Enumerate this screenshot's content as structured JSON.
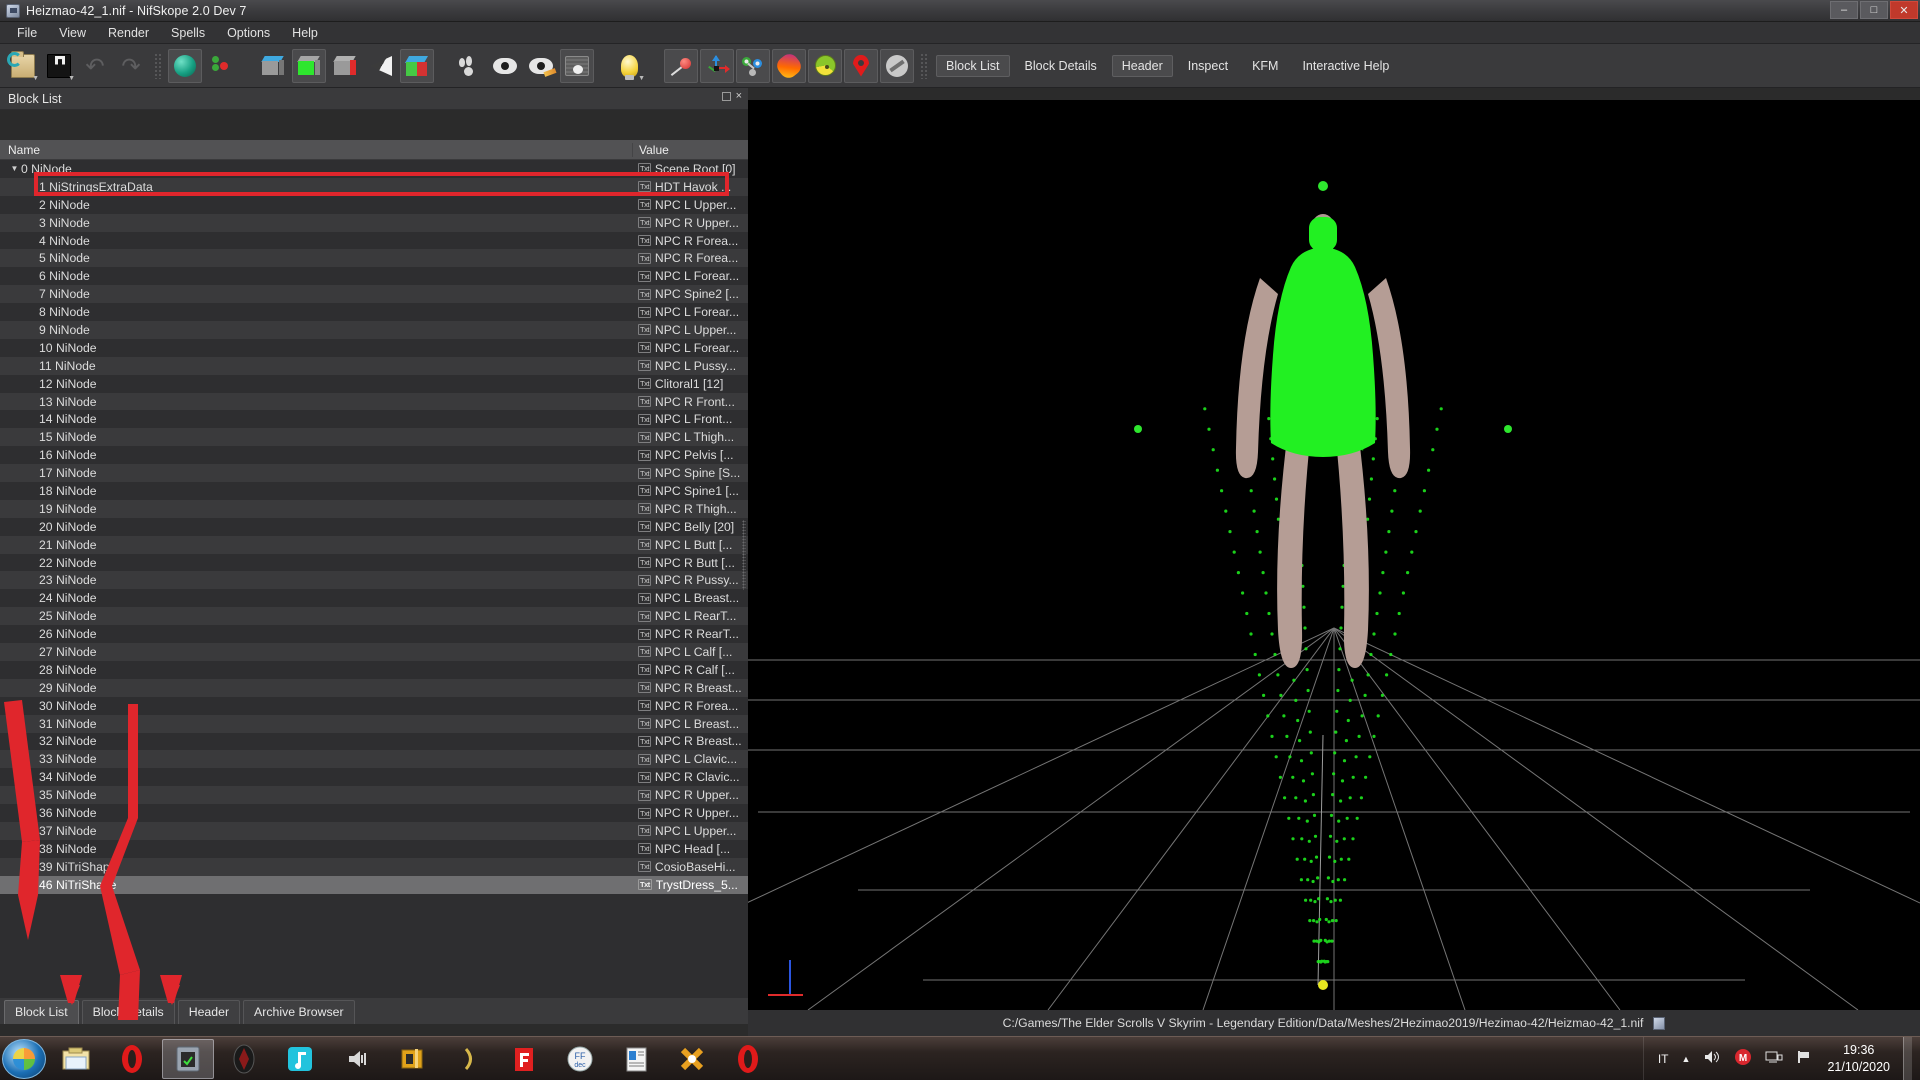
{
  "window": {
    "title": "Heizmao-42_1.nif - NifSkope 2.0 Dev 7",
    "icon": "nifskope-icon",
    "minimize": "–",
    "maximize": "□",
    "close": "✕"
  },
  "menu": [
    {
      "label": "File"
    },
    {
      "label": "View"
    },
    {
      "label": "Render"
    },
    {
      "label": "Spells"
    },
    {
      "label": "Options"
    },
    {
      "label": "Help"
    }
  ],
  "toolbar": {
    "icons": [
      {
        "name": "open-file-icon"
      },
      {
        "name": "save-file-icon"
      },
      {
        "name": "undo-icon"
      },
      {
        "name": "redo-icon"
      },
      {
        "name": "smooth-shading-icon"
      },
      {
        "name": "vertex-selection-icon"
      },
      {
        "name": "draw-nodes-icon"
      },
      {
        "name": "draw-collision-icon"
      },
      {
        "name": "draw-constraints-icon"
      },
      {
        "name": "draw-furniture-icon"
      },
      {
        "name": "axes-cube-icon"
      },
      {
        "name": "paw-icon"
      },
      {
        "name": "eye-icon"
      },
      {
        "name": "eye-highlight-icon"
      },
      {
        "name": "screenshot-icon"
      },
      {
        "name": "lightbulb-icon"
      },
      {
        "name": "pin-marker-icon"
      },
      {
        "name": "transform-axes-icon"
      },
      {
        "name": "node-graph-icon"
      },
      {
        "name": "bone-icon"
      },
      {
        "name": "pie-sphere-icon"
      },
      {
        "name": "marker-icon"
      },
      {
        "name": "hide-icon"
      }
    ],
    "buttons": [
      {
        "label": "Block List",
        "active": false
      },
      {
        "label": "Block Details",
        "active": false
      },
      {
        "label": "Header",
        "active": true
      },
      {
        "label": "Inspect",
        "active": false
      },
      {
        "label": "KFM",
        "active": false
      },
      {
        "label": "Interactive Help",
        "active": false
      }
    ]
  },
  "dock": {
    "title": "Block List",
    "float_button": "□",
    "close_button": "×",
    "collapse_arrow": "▼",
    "expand_arrow": "▲"
  },
  "tree": {
    "columns": [
      "Name",
      "Value"
    ],
    "rows": [
      {
        "index": "0",
        "type": "NiNode",
        "value": "Scene Root [0]",
        "badge": "Txt",
        "twisty": "▼",
        "depth": 0
      },
      {
        "index": "1",
        "type": "NiStringsExtraData",
        "value": "HDT Havok ...",
        "badge": "Txt",
        "twisty": "",
        "depth": 1
      },
      {
        "index": "2",
        "type": "NiNode",
        "value": "NPC L Upper...",
        "badge": "Txt",
        "twisty": "",
        "depth": 1
      },
      {
        "index": "3",
        "type": "NiNode",
        "value": "NPC R Upper...",
        "badge": "Txt",
        "twisty": "",
        "depth": 1
      },
      {
        "index": "4",
        "type": "NiNode",
        "value": "NPC R Forea...",
        "badge": "Txt",
        "twisty": "",
        "depth": 1
      },
      {
        "index": "5",
        "type": "NiNode",
        "value": "NPC R Forea...",
        "badge": "Txt",
        "twisty": "",
        "depth": 1
      },
      {
        "index": "6",
        "type": "NiNode",
        "value": "NPC L Forear...",
        "badge": "Txt",
        "twisty": "",
        "depth": 1
      },
      {
        "index": "7",
        "type": "NiNode",
        "value": "NPC Spine2 [...",
        "badge": "Txt",
        "twisty": "",
        "depth": 1
      },
      {
        "index": "8",
        "type": "NiNode",
        "value": "NPC L Forear...",
        "badge": "Txt",
        "twisty": "",
        "depth": 1
      },
      {
        "index": "9",
        "type": "NiNode",
        "value": "NPC L Upper...",
        "badge": "Txt",
        "twisty": "",
        "depth": 1
      },
      {
        "index": "10",
        "type": "NiNode",
        "value": "NPC L Forear...",
        "badge": "Txt",
        "twisty": "",
        "depth": 1
      },
      {
        "index": "11",
        "type": "NiNode",
        "value": "NPC L Pussy...",
        "badge": "Txt",
        "twisty": "",
        "depth": 1
      },
      {
        "index": "12",
        "type": "NiNode",
        "value": "Clitoral1 [12]",
        "badge": "Txt",
        "twisty": "",
        "depth": 1
      },
      {
        "index": "13",
        "type": "NiNode",
        "value": "NPC R Front...",
        "badge": "Txt",
        "twisty": "",
        "depth": 1
      },
      {
        "index": "14",
        "type": "NiNode",
        "value": "NPC L Front...",
        "badge": "Txt",
        "twisty": "",
        "depth": 1
      },
      {
        "index": "15",
        "type": "NiNode",
        "value": "NPC L Thigh...",
        "badge": "Txt",
        "twisty": "",
        "depth": 1
      },
      {
        "index": "16",
        "type": "NiNode",
        "value": "NPC Pelvis [...",
        "badge": "Txt",
        "twisty": "",
        "depth": 1
      },
      {
        "index": "17",
        "type": "NiNode",
        "value": "NPC Spine [S...",
        "badge": "Txt",
        "twisty": "",
        "depth": 1
      },
      {
        "index": "18",
        "type": "NiNode",
        "value": "NPC Spine1 [...",
        "badge": "Txt",
        "twisty": "",
        "depth": 1
      },
      {
        "index": "19",
        "type": "NiNode",
        "value": "NPC R Thigh...",
        "badge": "Txt",
        "twisty": "",
        "depth": 1
      },
      {
        "index": "20",
        "type": "NiNode",
        "value": "NPC Belly [20]",
        "badge": "Txt",
        "twisty": "",
        "depth": 1
      },
      {
        "index": "21",
        "type": "NiNode",
        "value": "NPC L Butt [...",
        "badge": "Txt",
        "twisty": "",
        "depth": 1
      },
      {
        "index": "22",
        "type": "NiNode",
        "value": "NPC R Butt [...",
        "badge": "Txt",
        "twisty": "",
        "depth": 1
      },
      {
        "index": "23",
        "type": "NiNode",
        "value": "NPC R Pussy...",
        "badge": "Txt",
        "twisty": "",
        "depth": 1
      },
      {
        "index": "24",
        "type": "NiNode",
        "value": "NPC L Breast...",
        "badge": "Txt",
        "twisty": "",
        "depth": 1
      },
      {
        "index": "25",
        "type": "NiNode",
        "value": "NPC L RearT...",
        "badge": "Txt",
        "twisty": "",
        "depth": 1
      },
      {
        "index": "26",
        "type": "NiNode",
        "value": "NPC R RearT...",
        "badge": "Txt",
        "twisty": "",
        "depth": 1
      },
      {
        "index": "27",
        "type": "NiNode",
        "value": "NPC L Calf [...",
        "badge": "Txt",
        "twisty": "",
        "depth": 1
      },
      {
        "index": "28",
        "type": "NiNode",
        "value": "NPC R Calf [...",
        "badge": "Txt",
        "twisty": "",
        "depth": 1
      },
      {
        "index": "29",
        "type": "NiNode",
        "value": "NPC R Breast...",
        "badge": "Txt",
        "twisty": "",
        "depth": 1
      },
      {
        "index": "30",
        "type": "NiNode",
        "value": "NPC R Forea...",
        "badge": "Txt",
        "twisty": "",
        "depth": 1
      },
      {
        "index": "31",
        "type": "NiNode",
        "value": "NPC L Breast...",
        "badge": "Txt",
        "twisty": "",
        "depth": 1
      },
      {
        "index": "32",
        "type": "NiNode",
        "value": "NPC R Breast...",
        "badge": "Txt",
        "twisty": "",
        "depth": 1
      },
      {
        "index": "33",
        "type": "NiNode",
        "value": "NPC L Clavic...",
        "badge": "Txt",
        "twisty": "",
        "depth": 1
      },
      {
        "index": "34",
        "type": "NiNode",
        "value": "NPC R Clavic...",
        "badge": "Txt",
        "twisty": "",
        "depth": 1
      },
      {
        "index": "35",
        "type": "NiNode",
        "value": "NPC R Upper...",
        "badge": "Txt",
        "twisty": "",
        "depth": 1
      },
      {
        "index": "36",
        "type": "NiNode",
        "value": "NPC R Upper...",
        "badge": "Txt",
        "twisty": "",
        "depth": 1
      },
      {
        "index": "37",
        "type": "NiNode",
        "value": "NPC L Upper...",
        "badge": "Txt",
        "twisty": "",
        "depth": 1
      },
      {
        "index": "38",
        "type": "NiNode",
        "value": "NPC Head [...",
        "badge": "Txt",
        "twisty": "",
        "depth": 1
      },
      {
        "index": "39",
        "type": "NiTriShape",
        "value": "CosioBaseHi...",
        "badge": "Txt",
        "twisty": "▶",
        "depth": 1
      },
      {
        "index": "46",
        "type": "NiTriShape",
        "value": "TrystDress_5...",
        "badge": "Txt",
        "twisty": "",
        "depth": 1,
        "selected": true
      }
    ]
  },
  "bottom_tabs": [
    {
      "label": "Block List",
      "active": true
    },
    {
      "label": "Block Details",
      "active": false
    },
    {
      "label": "Header",
      "active": false
    },
    {
      "label": "Archive Browser",
      "active": false
    }
  ],
  "statusbar": {
    "path": "C:/Games/The Elder Scrolls V Skyrim - Legendary Edition/Data/Meshes/2Hezimao2019/Hezimao-42/Heizmao-42_1.nif",
    "icon": "file-icon"
  },
  "annotations": {
    "color": "#e0262c",
    "highlight_row_1": "NiStringsExtraData row outlined in red",
    "bracket": "red bracket around rows 30-38",
    "arrow_block_list_tab": "red arrow pointing to Block List tab",
    "arrow_block_details_tab": "red arrow pointing to Block Details tab"
  },
  "viewport": {
    "model_colors": {
      "dress": "#22f022",
      "skin": "#b39a92",
      "grid": "#8f8f8f",
      "node_top": "#2ee62e",
      "node_bottom": "#e8e820"
    },
    "gizmo": {
      "x_color": "#e02b2b",
      "z_color": "#2b55e0"
    }
  },
  "taskbar": {
    "start_label": "start-orb",
    "items": [
      {
        "name": "explorer-icon"
      },
      {
        "name": "opera-icon"
      },
      {
        "name": "nifskope-icon",
        "active": true
      },
      {
        "name": "skyrim-icon"
      },
      {
        "name": "music-player-icon"
      },
      {
        "name": "audio-icon"
      },
      {
        "name": "bodyslide-icon"
      },
      {
        "name": "curve-icon"
      },
      {
        "name": "f-app-icon"
      },
      {
        "name": "ffdec-icon"
      },
      {
        "name": "document-icon"
      },
      {
        "name": "xnview-icon"
      },
      {
        "name": "opera-icon-2"
      }
    ],
    "tray": {
      "language": "IT",
      "show_hidden": "▲",
      "volume_icon": "volume-icon",
      "mega_icon": "M",
      "network_icon": "network-icon",
      "action_center_icon": "flag-icon"
    },
    "clock": {
      "time": "19:36",
      "date": "21/10/2020"
    }
  }
}
